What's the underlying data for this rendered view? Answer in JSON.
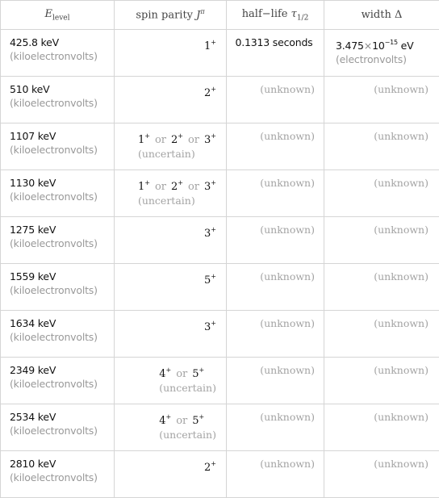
{
  "header": {
    "col1_main": "E",
    "col1_sub": "level",
    "col2_text": "spin parity ",
    "col2_sym": "J",
    "col2_sup": "π",
    "col3_text": "half−life ",
    "col3_sym": "τ",
    "col3_sub": "1/2",
    "col4_text": "width Δ"
  },
  "rows": [
    {
      "energy": "425.8 keV",
      "energy_unit": "(kiloelectronvolts)",
      "spin": [
        "1"
      ],
      "uncertain": "",
      "half_life": "0.1313 seconds",
      "width_mantissa": "3.475",
      "width_exp": "−15",
      "width_unit_abbr": "eV",
      "width_unit": "(electronvolts)"
    },
    {
      "energy": "510 keV",
      "energy_unit": "(kiloelectronvolts)",
      "spin": [
        "2"
      ],
      "uncertain": "",
      "half_life": "(unknown)",
      "width": "(unknown)"
    },
    {
      "energy": "1107 keV",
      "energy_unit": "(kiloelectronvolts)",
      "spin": [
        "1",
        "2",
        "3"
      ],
      "uncertain": "(uncertain)",
      "half_life": "(unknown)",
      "width": "(unknown)"
    },
    {
      "energy": "1130 keV",
      "energy_unit": "(kiloelectronvolts)",
      "spin": [
        "1",
        "2",
        "3"
      ],
      "uncertain": "(uncertain)",
      "half_life": "(unknown)",
      "width": "(unknown)"
    },
    {
      "energy": "1275 keV",
      "energy_unit": "(kiloelectronvolts)",
      "spin": [
        "3"
      ],
      "uncertain": "",
      "half_life": "(unknown)",
      "width": "(unknown)"
    },
    {
      "energy": "1559 keV",
      "energy_unit": "(kiloelectronvolts)",
      "spin": [
        "5"
      ],
      "uncertain": "",
      "half_life": "(unknown)",
      "width": "(unknown)"
    },
    {
      "energy": "1634 keV",
      "energy_unit": "(kiloelectronvolts)",
      "spin": [
        "3"
      ],
      "uncertain": "",
      "half_life": "(unknown)",
      "width": "(unknown)"
    },
    {
      "energy": "2349 keV",
      "energy_unit": "(kiloelectronvolts)",
      "spin": [
        "4",
        "5"
      ],
      "uncertain": "(uncertain)",
      "half_life": "(unknown)",
      "width": "(unknown)"
    },
    {
      "energy": "2534 keV",
      "energy_unit": "(kiloelectronvolts)",
      "spin": [
        "4",
        "5"
      ],
      "uncertain": "(uncertain)",
      "half_life": "(unknown)",
      "width": "(unknown)"
    },
    {
      "energy": "2810 keV",
      "energy_unit": "(kiloelectronvolts)",
      "spin": [
        "2"
      ],
      "uncertain": "",
      "half_life": "(unknown)",
      "width": "(unknown)"
    }
  ],
  "labels": {
    "or": "or",
    "parity": "+",
    "times": "×",
    "ten": "10"
  }
}
